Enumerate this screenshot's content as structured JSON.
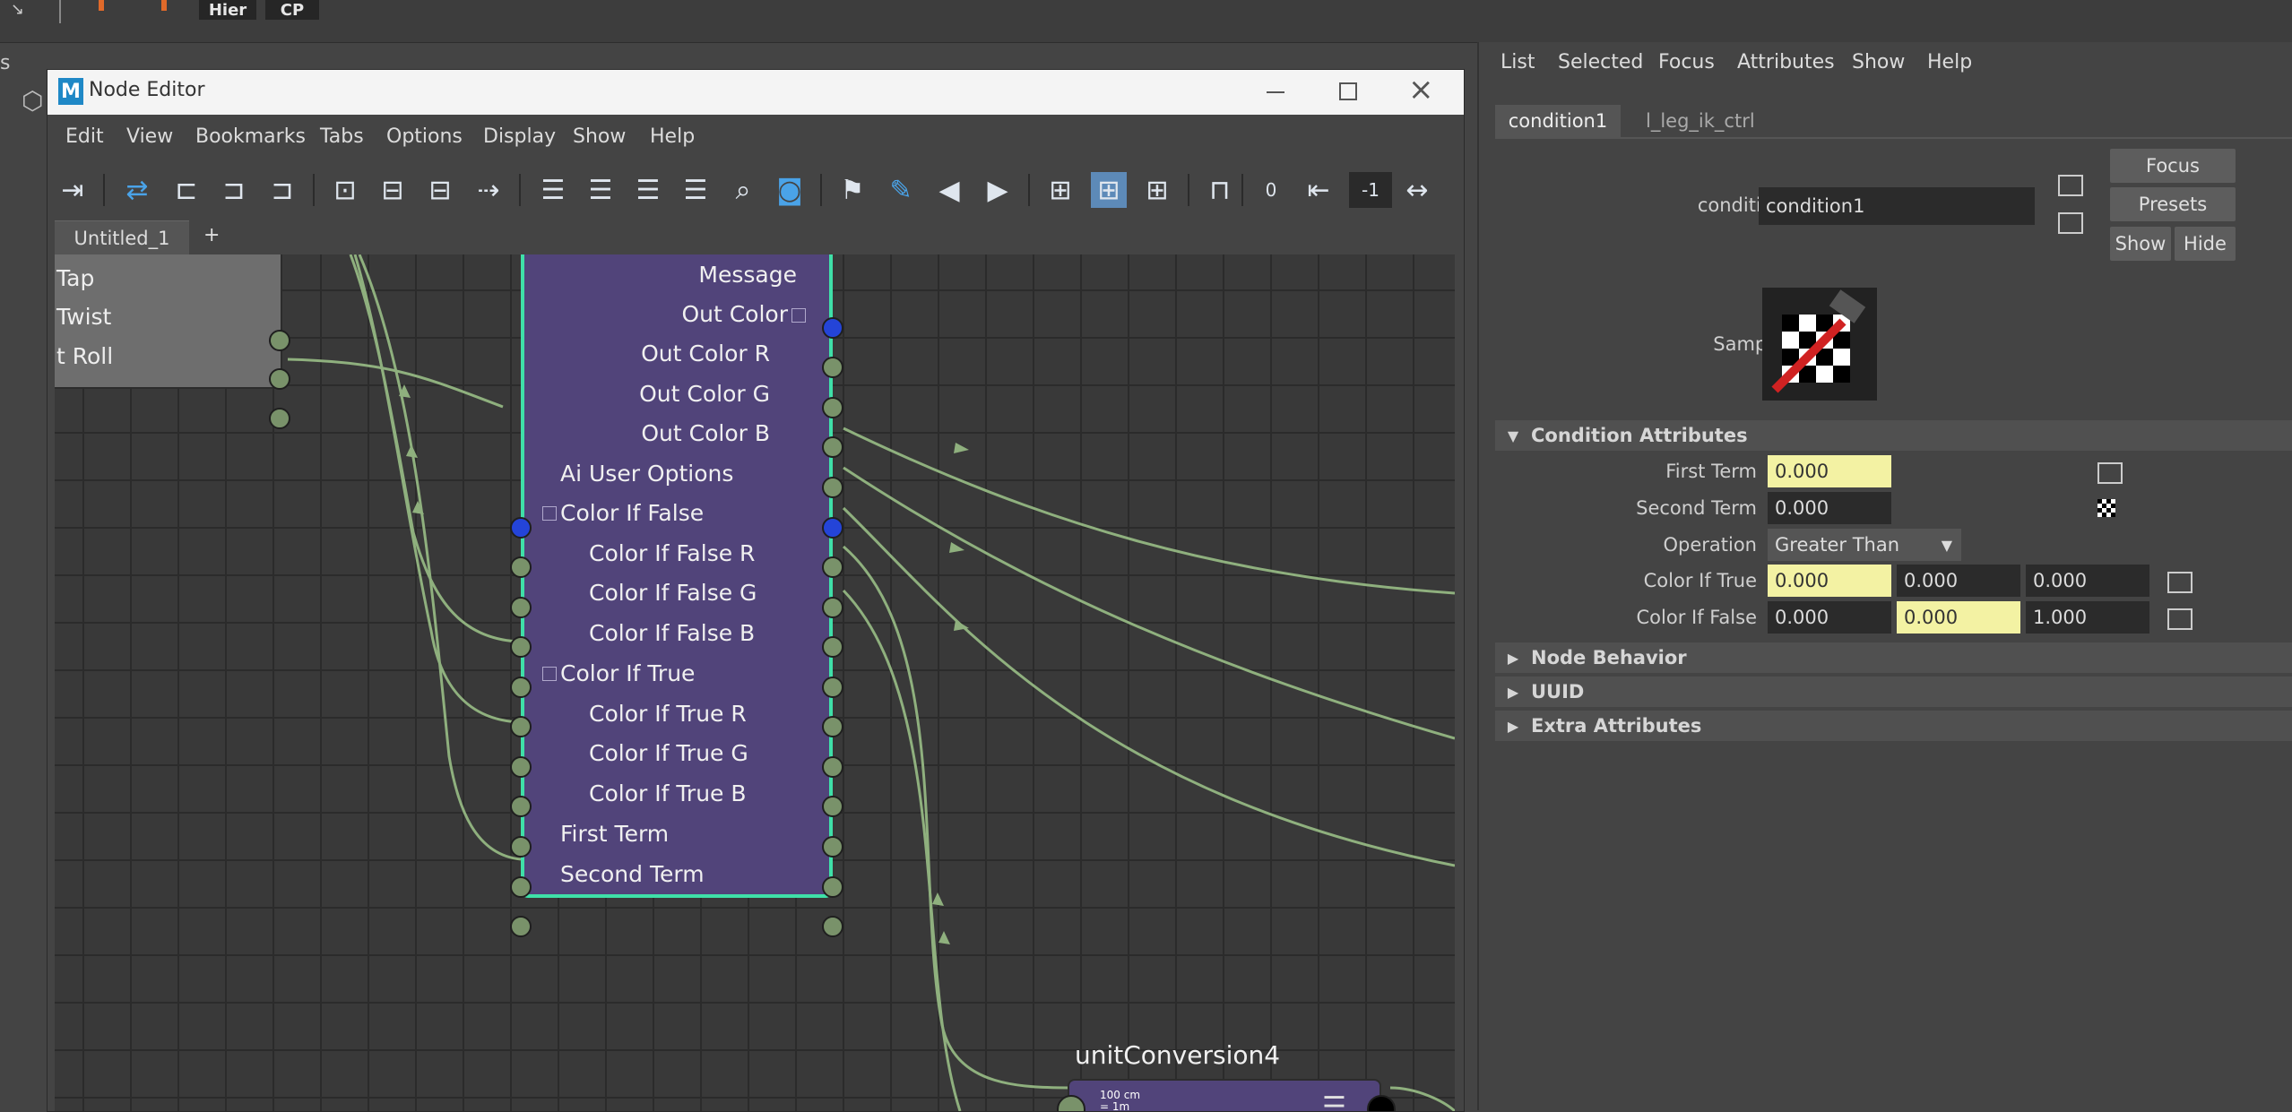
{
  "topbar": {
    "hier_label": "Hier",
    "cp_label": "CP",
    "left_char": "s"
  },
  "node_editor": {
    "title": "Node Editor",
    "logo_letter": "M",
    "menus": [
      "Edit",
      "View",
      "Bookmarks",
      "Tabs",
      "Options",
      "Display",
      "Show",
      "Help"
    ],
    "tab_name": "Untitled_1",
    "add_tab_label": "+",
    "toolbar": {
      "field_0": "0",
      "field_neg1": "-1"
    }
  },
  "graph": {
    "left_node": {
      "attrs": [
        "Tap",
        "Twist",
        "t Roll"
      ]
    },
    "condition_node": {
      "attrs": [
        "Message",
        "Out Color",
        "Out Color R",
        "Out Color G",
        "Out Color B",
        "Ai User Options",
        "Color If False",
        "Color If False R",
        "Color If False G",
        "Color If False B",
        "Color If True",
        "Color If True R",
        "Color If True G",
        "Color If True B",
        "First Term",
        "Second Term"
      ]
    },
    "unit_conversion": {
      "name": "unitConversion4",
      "icon_text_1": "100 cm",
      "icon_text_2": "= 1m"
    }
  },
  "attr_editor": {
    "menus": [
      "List",
      "Selected",
      "Focus",
      "Attributes",
      "Show",
      "Help"
    ],
    "tabs": [
      "condition1",
      "l_leg_ik_ctrl"
    ],
    "condition_label": "condition:",
    "condition_value": "condition1",
    "buttons": {
      "focus": "Focus",
      "presets": "Presets",
      "show": "Show",
      "hide": "Hide"
    },
    "sample_label": "Sample",
    "sections": {
      "condition_attributes": "Condition Attributes",
      "node_behavior": "Node Behavior",
      "uuid": "UUID",
      "extra_attributes": "Extra Attributes"
    },
    "first_term": {
      "label": "First Term",
      "value": "0.000"
    },
    "second_term": {
      "label": "Second Term",
      "value": "0.000"
    },
    "operation": {
      "label": "Operation",
      "value": "Greater Than"
    },
    "color_if_true": {
      "label": "Color If True",
      "values": [
        "0.000",
        "0.000",
        "0.000"
      ]
    },
    "color_if_false": {
      "label": "Color If False",
      "values": [
        "0.000",
        "0.000",
        "1.000"
      ]
    }
  },
  "colors": {
    "accent_highlight": "#f3f2a3",
    "node_body": "#51447a",
    "node_selected_border": "#3fe0a8",
    "connection": "#8fb07e"
  }
}
